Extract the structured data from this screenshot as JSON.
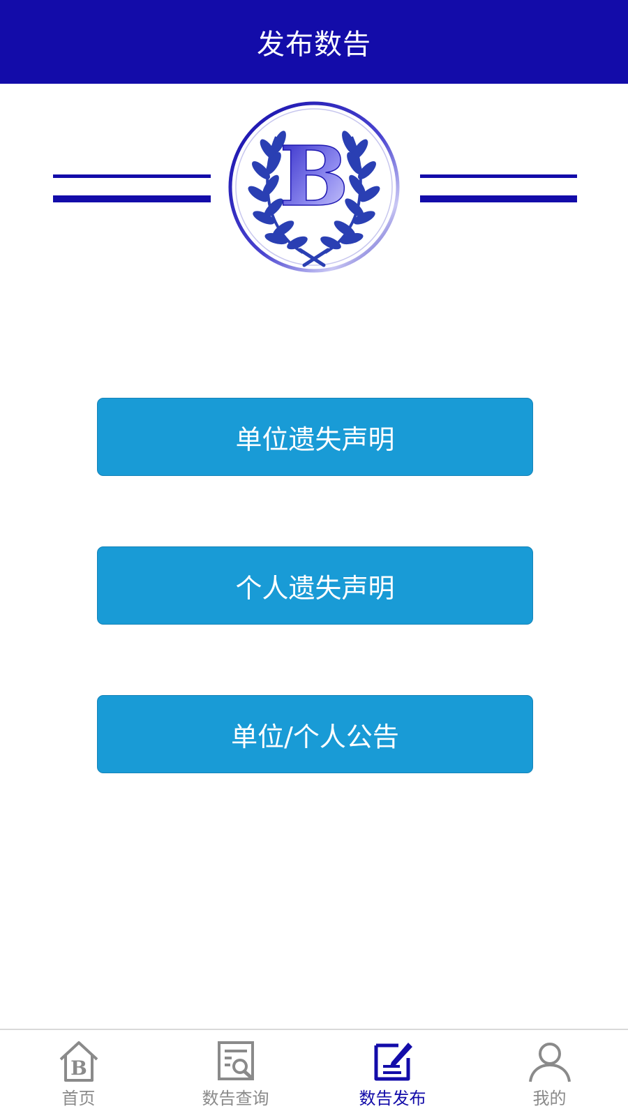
{
  "header": {
    "title": "发布数告"
  },
  "logo": {
    "letter": "B"
  },
  "actions": [
    {
      "label": "单位遗失声明"
    },
    {
      "label": "个人遗失声明"
    },
    {
      "label": "单位/个人公告"
    }
  ],
  "tabs": [
    {
      "label": "首页",
      "icon": "home-icon",
      "active": false
    },
    {
      "label": "数告查询",
      "icon": "search-document-icon",
      "active": false
    },
    {
      "label": "数告发布",
      "icon": "edit-document-icon",
      "active": true
    },
    {
      "label": "我的",
      "icon": "user-icon",
      "active": false
    }
  ],
  "colors": {
    "brand": "#130ca9",
    "button": "#199bd6",
    "inactive_tab": "#8a8a8a"
  }
}
